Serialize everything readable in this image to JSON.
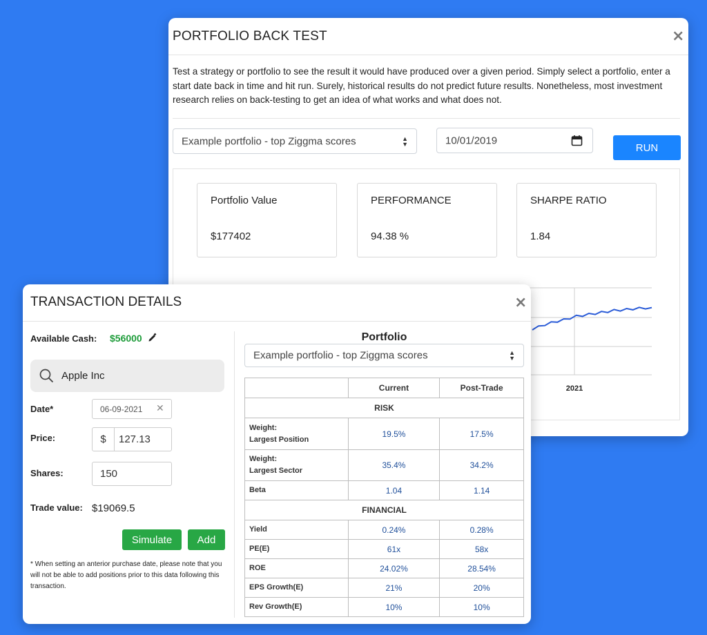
{
  "backtest": {
    "title": "PORTFOLIO BACK TEST",
    "close": "×",
    "description": "Test a strategy or portfolio to see the result it would have produced over a given period. Simply select a portfolio, enter a start date back in time and hit run. Surely, historical results do not predict future results. Nonetheless, most investment research relies on back-testing to get an idea of what works and what does not.",
    "portfolio_select": "Example portfolio - top Ziggma scores",
    "date_value": "10/01/2019",
    "run_label": "RUN",
    "cards": [
      {
        "label": "Portfolio Value",
        "value": "$177402"
      },
      {
        "label": "PERFORMANCE",
        "value": "94.38 %"
      },
      {
        "label": "SHARPE RATIO",
        "value": "1.84"
      }
    ],
    "chart_tick": "2021"
  },
  "chart_data": {
    "type": "line",
    "title": "",
    "xlabel": "",
    "ylabel": "",
    "x_tick_labels": [
      "2021"
    ],
    "series": [
      {
        "color": "#2a5bd7",
        "values": [
          0.1,
          0.18,
          0.28,
          0.35,
          0.42,
          0.47,
          0.55,
          0.62,
          0.66,
          0.7,
          0.74,
          0.78,
          0.82,
          0.86,
          0.88,
          0.9,
          0.93,
          0.95,
          0.97,
          0.94
        ]
      }
    ],
    "grid": true
  },
  "transaction": {
    "title": "TRANSACTION DETAILS",
    "close": "×",
    "available_cash_label": "Available Cash:",
    "available_cash_value": "$56000",
    "search_value": "Apple Inc",
    "date_label": "Date*",
    "date_value": "06-09-2021",
    "price_label": "Price:",
    "price_prefix": "$",
    "price_value": "127.13",
    "shares_label": "Shares:",
    "shares_value": "150",
    "trade_value_label": "Trade value:",
    "trade_value": "$19069.5",
    "simulate_label": "Simulate",
    "add_label": "Add",
    "note": "* When setting an anterior purchase date, please note that you will not be able to add positions prior to this data following this transaction.",
    "portfolio_heading": "Portfolio",
    "portfolio_select": "Example portfolio - top Ziggma scores",
    "table": {
      "headers": [
        "",
        "Current",
        "Post-Trade"
      ],
      "risk_label": "RISK",
      "risk_rows": [
        {
          "label": "Weight:\nLargest Position",
          "current": "19.5%",
          "post": "17.5%"
        },
        {
          "label": "Weight:\nLargest Sector",
          "current": "35.4%",
          "post": "34.2%"
        },
        {
          "label": "Beta",
          "current": "1.04",
          "post": "1.14"
        }
      ],
      "financial_label": "FINANCIAL",
      "financial_rows": [
        {
          "label": "Yield",
          "current": "0.24%",
          "post": "0.28%"
        },
        {
          "label": "PE(E)",
          "current": "61x",
          "post": "58x"
        },
        {
          "label": "ROE",
          "current": "24.02%",
          "post": "28.54%"
        },
        {
          "label": "EPS Growth(E)",
          "current": "21%",
          "post": "20%"
        },
        {
          "label": "Rev Growth(E)",
          "current": "10%",
          "post": "10%"
        }
      ]
    }
  }
}
